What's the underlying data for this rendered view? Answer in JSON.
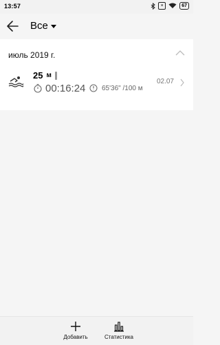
{
  "status_bar": {
    "time": "13:57",
    "icons": [
      "bluetooth-icon",
      "sim-x-icon",
      "wifi-icon",
      "battery-icon"
    ],
    "battery": "67"
  },
  "toolbar": {
    "back_icon": "arrow-left-icon",
    "filter_label": "Все"
  },
  "list": {
    "month": "июль 2019 г.",
    "workout": {
      "distance_value": "25",
      "distance_unit": "м",
      "duration": "00:16:24",
      "pace": "65'36\" /100 м",
      "date": "02.07"
    }
  },
  "bottom_bar": {
    "add_label": "Добавить",
    "stats_label": "Статистика"
  }
}
